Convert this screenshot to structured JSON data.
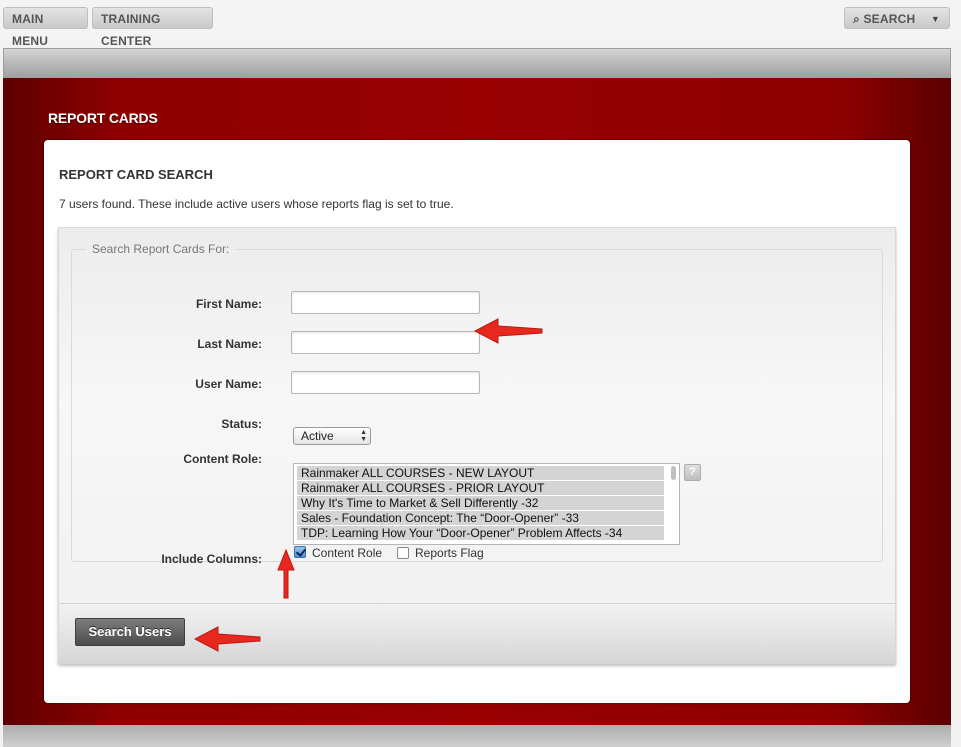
{
  "topnav": {
    "main_menu": "MAIN MENU",
    "training_center": "TRAINING CENTER",
    "search": "SEARCH"
  },
  "page": {
    "title": "REPORT CARDS"
  },
  "card": {
    "title": "REPORT CARD SEARCH",
    "info": "7 users found. These include active users whose reports flag is set to true."
  },
  "form": {
    "legend": "Search Report Cards For:",
    "first_name_label": "First Name:",
    "first_name_value": "",
    "last_name_label": "Last Name:",
    "last_name_value": "",
    "user_name_label": "User Name:",
    "user_name_value": "",
    "status_label": "Status:",
    "status_value": "Active",
    "content_role_label": "Content Role:",
    "content_roles": [
      "Rainmaker ALL COURSES - NEW LAYOUT",
      "Rainmaker ALL COURSES - PRIOR LAYOUT",
      "Why It's Time to Market & Sell Differently -32",
      "Sales - Foundation Concept: The “Door-Opener” -33",
      "TDP: Learning How Your “Door-Opener” Problem Affects -34"
    ],
    "help_label": "?",
    "include_columns_label": "Include Columns:",
    "columns": [
      {
        "label": "Content Role",
        "checked": true
      },
      {
        "label": "Reports Flag",
        "checked": false
      }
    ],
    "submit_label": "Search Users"
  },
  "colors": {
    "brand_red": "#980000",
    "annotation_arrow": "#e8281e"
  }
}
